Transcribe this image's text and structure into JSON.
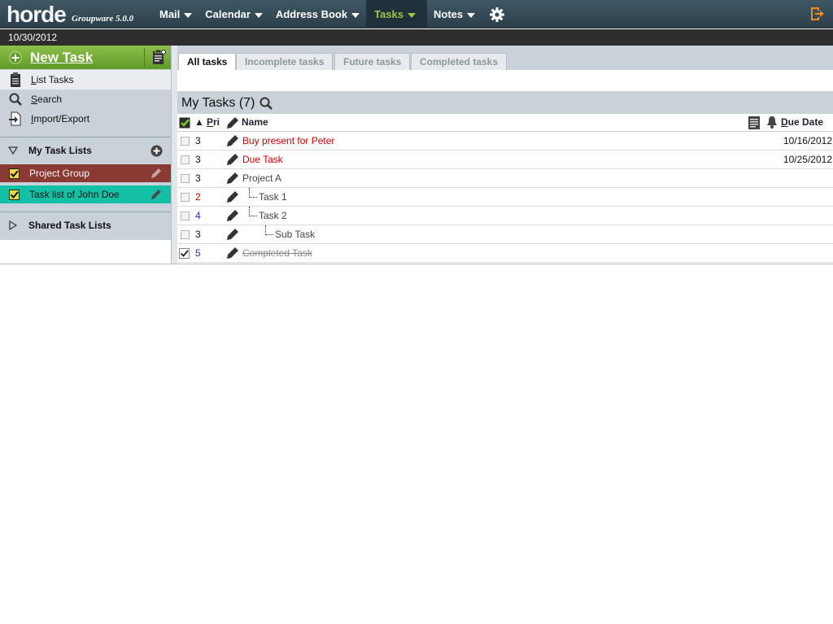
{
  "app": {
    "logo": "horde",
    "subtitle": "Groupware 5.0.0"
  },
  "nav": {
    "items": [
      {
        "label": "Mail"
      },
      {
        "label": "Calendar"
      },
      {
        "label": "Address Book"
      },
      {
        "label": "Tasks"
      },
      {
        "label": "Notes"
      }
    ],
    "active": "Tasks"
  },
  "date": "10/30/2012",
  "sidebar": {
    "new_task": "New Task",
    "links": [
      {
        "label": "List Tasks",
        "icon": "clipboard-icon"
      },
      {
        "label": "Search",
        "icon": "search-icon"
      },
      {
        "label": "Import/Export",
        "icon": "import-export-icon"
      }
    ],
    "my_task_lists": {
      "title": "My Task Lists",
      "lists": [
        {
          "label": "Project Group",
          "color": "#8b3a33"
        },
        {
          "label": "Task list of John Doe",
          "color": "#13c0a6"
        }
      ]
    },
    "shared_task_lists": {
      "title": "Shared Task Lists"
    }
  },
  "tabs": [
    {
      "label": "All tasks",
      "active": true
    },
    {
      "label": "Incomplete tasks",
      "active": false
    },
    {
      "label": "Future tasks",
      "active": false
    },
    {
      "label": "Completed tasks",
      "active": false
    }
  ],
  "list": {
    "title": "My Tasks (7)",
    "headers": {
      "pri": "Pri",
      "name": "Name",
      "due": "Due Date",
      "sort_indicator": "▲"
    },
    "rows": [
      {
        "pri": "3",
        "name": "Buy present for Peter",
        "due": "10/16/2012",
        "style": "overdue"
      },
      {
        "pri": "3",
        "name": "Due Task",
        "due": "10/25/2012",
        "style": "overdue"
      },
      {
        "pri": "3",
        "name": "Project A",
        "due": "",
        "style": "normal"
      },
      {
        "pri": "2",
        "name": "Task 1",
        "due": "",
        "style": "normal"
      },
      {
        "pri": "4",
        "name": "Task 2",
        "due": "",
        "style": "normal"
      },
      {
        "pri": "3",
        "name": "Sub Task",
        "due": "",
        "style": "normal"
      },
      {
        "pri": "5",
        "name": "Completed Task",
        "due": "",
        "style": "completed"
      }
    ]
  },
  "colors": {
    "accent_green": "#6aa72f",
    "topbar": "#34505e",
    "overdue_red": "#cc0000",
    "pri_red": "#cc0000",
    "pri_blue": "#1b35b5"
  }
}
